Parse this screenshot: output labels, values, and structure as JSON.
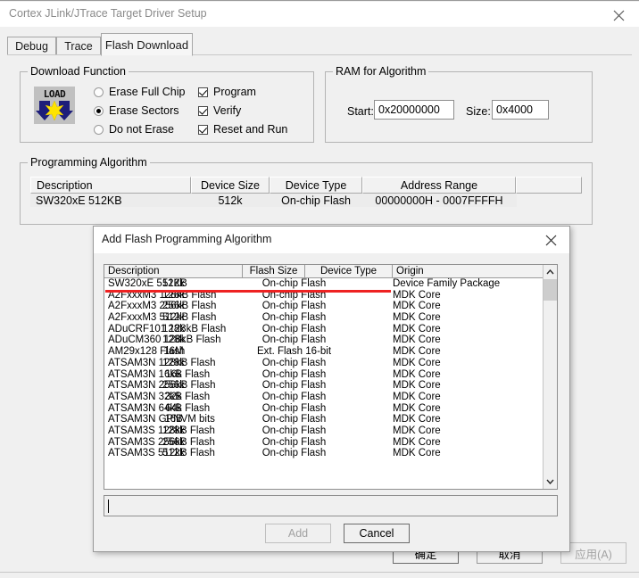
{
  "window": {
    "title": "Cortex JLink/JTrace Target Driver Setup",
    "close_icon": "close-icon"
  },
  "tabs": [
    {
      "label": "Debug",
      "active": false
    },
    {
      "label": "Trace",
      "active": false
    },
    {
      "label": "Flash Download",
      "active": true
    }
  ],
  "download_function": {
    "title": "Download Function",
    "icon_label": "LOAD",
    "radios": [
      {
        "label": "Erase Full Chip",
        "checked": false
      },
      {
        "label": "Erase Sectors",
        "checked": true
      },
      {
        "label": "Do not Erase",
        "checked": false
      }
    ],
    "checkboxes": [
      {
        "label": "Program",
        "checked": true
      },
      {
        "label": "Verify",
        "checked": true
      },
      {
        "label": "Reset and Run",
        "checked": true
      }
    ]
  },
  "ram_for_algorithm": {
    "title": "RAM for Algorithm",
    "start_label": "Start:",
    "start_value": "0x20000000",
    "size_label": "Size:",
    "size_value": "0x4000"
  },
  "programming_algorithm": {
    "title": "Programming Algorithm",
    "columns": [
      "Description",
      "Device Size",
      "Device Type",
      "Address Range",
      ""
    ],
    "rows": [
      {
        "description": "SW320xE 512KB",
        "device_size": "512k",
        "device_type": "On-chip Flash",
        "address_range": "00000000H - 0007FFFFH"
      }
    ]
  },
  "main_buttons": [
    {
      "label": "确定",
      "disabled": false,
      "default": true
    },
    {
      "label": "取消",
      "disabled": false,
      "default": false
    },
    {
      "label": "应用(A)",
      "disabled": true,
      "default": false
    }
  ],
  "modal": {
    "title": "Add Flash Programming Algorithm",
    "close_icon": "close-icon",
    "columns": [
      "Description",
      "Flash Size",
      "Device Type",
      "Origin"
    ],
    "rows": [
      {
        "description": "SW320xE 512KB",
        "flash_size": "512k",
        "device_type": "On-chip Flash",
        "origin": "Device Family Package"
      },
      {
        "description": "A2FxxxM3 128kB Flash",
        "flash_size": "128k",
        "device_type": "On-chip Flash",
        "origin": "MDK Core"
      },
      {
        "description": "A2FxxxM3 256kB Flash",
        "flash_size": "256k",
        "device_type": "On-chip Flash",
        "origin": "MDK Core"
      },
      {
        "description": "A2FxxxM3 512kB Flash",
        "flash_size": "512k",
        "device_type": "On-chip Flash",
        "origin": "MDK Core"
      },
      {
        "description": "ADuCRF101 128kB Flash",
        "flash_size": "128k",
        "device_type": "On-chip Flash",
        "origin": "MDK Core"
      },
      {
        "description": "ADuCM360 128kB Flash",
        "flash_size": "128k",
        "device_type": "On-chip Flash",
        "origin": "MDK Core"
      },
      {
        "description": "AM29x128 Flash",
        "flash_size": "16M",
        "device_type": "Ext. Flash 16-bit",
        "origin": "MDK Core"
      },
      {
        "description": "ATSAM3N 128kB Flash",
        "flash_size": "128k",
        "device_type": "On-chip Flash",
        "origin": "MDK Core"
      },
      {
        "description": "ATSAM3N 16kB Flash",
        "flash_size": "16k",
        "device_type": "On-chip Flash",
        "origin": "MDK Core"
      },
      {
        "description": "ATSAM3N 256kB Flash",
        "flash_size": "256k",
        "device_type": "On-chip Flash",
        "origin": "MDK Core"
      },
      {
        "description": "ATSAM3N 32kB Flash",
        "flash_size": "32k",
        "device_type": "On-chip Flash",
        "origin": "MDK Core"
      },
      {
        "description": "ATSAM3N 64kB Flash",
        "flash_size": "64k",
        "device_type": "On-chip Flash",
        "origin": "MDK Core"
      },
      {
        "description": "ATSAM3N GPNVM bits",
        "flash_size": "16B",
        "device_type": "On-chip Flash",
        "origin": "MDK Core"
      },
      {
        "description": "ATSAM3S 128kB Flash",
        "flash_size": "128k",
        "device_type": "On-chip Flash",
        "origin": "MDK Core"
      },
      {
        "description": "ATSAM3S 256kB Flash",
        "flash_size": "256k",
        "device_type": "On-chip Flash",
        "origin": "MDK Core"
      },
      {
        "description": "ATSAM3S 512kB Flash",
        "flash_size": "512k",
        "device_type": "On-chip Flash",
        "origin": "MDK Core"
      }
    ],
    "scrollbar": {
      "up_icon": "chevron-up-icon",
      "down_icon": "chevron-down-icon"
    },
    "input_value": "",
    "buttons": [
      {
        "label": "Add",
        "disabled": true
      },
      {
        "label": "Cancel",
        "disabled": false
      }
    ]
  },
  "annotation": {
    "color": "#ee2222"
  }
}
